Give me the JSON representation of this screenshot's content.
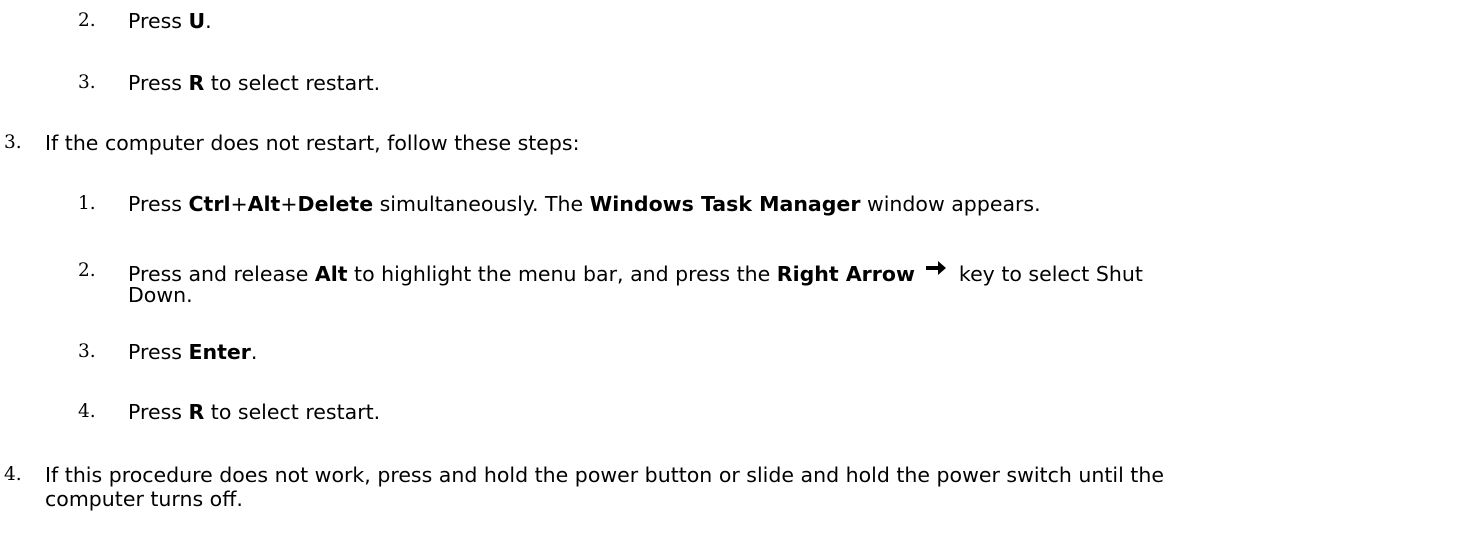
{
  "steps": {
    "s2_2": {
      "num": "2.",
      "pre": "Press ",
      "key": "U",
      "post": "."
    },
    "s2_3": {
      "num": "3.",
      "pre": "Press ",
      "key": "R",
      "post": " to select restart."
    },
    "s3": {
      "num": "3.",
      "text": "If the computer does not restart, follow these steps:"
    },
    "s3_1": {
      "num": "1.",
      "pre": "Press ",
      "key1": "Ctrl",
      "plus1": "+",
      "key2": "Alt",
      "plus2": "+",
      "key3": "Delete",
      "mid": " simultaneously. The ",
      "window": "Windows Task Manager",
      "post": " window appears."
    },
    "s3_2": {
      "num": "2.",
      "pre": "Press and release ",
      "key1": "Alt",
      "mid": " to highlight the menu bar, and press the ",
      "key2": "Right Arrow",
      "arrow_icon": "right-arrow-icon",
      "post_line1": "key to select Shut",
      "post_line2": "Down."
    },
    "s3_3": {
      "num": "3.",
      "pre": "Press ",
      "key": "Enter",
      "post": "."
    },
    "s3_4": {
      "num": "4.",
      "pre": "Press ",
      "key": "R",
      "post": " to select restart."
    },
    "s4": {
      "num": "4.",
      "line1": "If this procedure does not work, press and hold the power button or slide and hold the power switch until the",
      "line2": "computer turns off."
    }
  }
}
